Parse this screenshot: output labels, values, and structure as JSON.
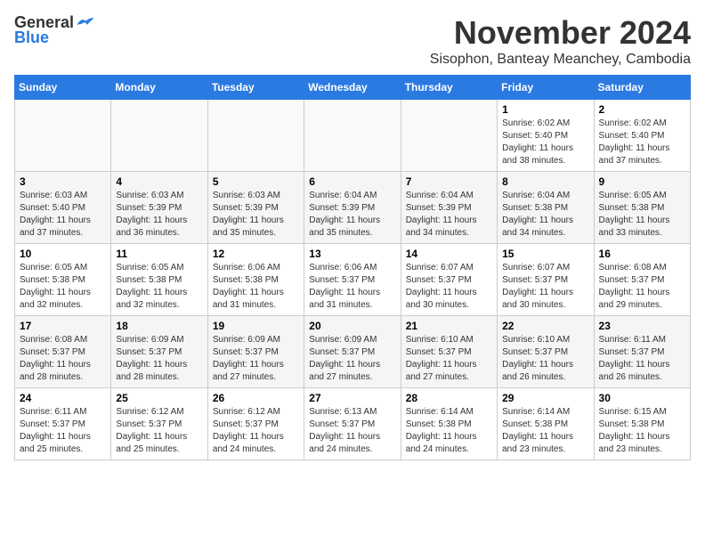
{
  "header": {
    "logo_general": "General",
    "logo_blue": "Blue",
    "month_title": "November 2024",
    "subtitle": "Sisophon, Banteay Meanchey, Cambodia"
  },
  "days_of_week": [
    "Sunday",
    "Monday",
    "Tuesday",
    "Wednesday",
    "Thursday",
    "Friday",
    "Saturday"
  ],
  "weeks": [
    [
      {
        "day": "",
        "info": ""
      },
      {
        "day": "",
        "info": ""
      },
      {
        "day": "",
        "info": ""
      },
      {
        "day": "",
        "info": ""
      },
      {
        "day": "",
        "info": ""
      },
      {
        "day": "1",
        "info": "Sunrise: 6:02 AM\nSunset: 5:40 PM\nDaylight: 11 hours\nand 38 minutes."
      },
      {
        "day": "2",
        "info": "Sunrise: 6:02 AM\nSunset: 5:40 PM\nDaylight: 11 hours\nand 37 minutes."
      }
    ],
    [
      {
        "day": "3",
        "info": "Sunrise: 6:03 AM\nSunset: 5:40 PM\nDaylight: 11 hours\nand 37 minutes."
      },
      {
        "day": "4",
        "info": "Sunrise: 6:03 AM\nSunset: 5:39 PM\nDaylight: 11 hours\nand 36 minutes."
      },
      {
        "day": "5",
        "info": "Sunrise: 6:03 AM\nSunset: 5:39 PM\nDaylight: 11 hours\nand 35 minutes."
      },
      {
        "day": "6",
        "info": "Sunrise: 6:04 AM\nSunset: 5:39 PM\nDaylight: 11 hours\nand 35 minutes."
      },
      {
        "day": "7",
        "info": "Sunrise: 6:04 AM\nSunset: 5:39 PM\nDaylight: 11 hours\nand 34 minutes."
      },
      {
        "day": "8",
        "info": "Sunrise: 6:04 AM\nSunset: 5:38 PM\nDaylight: 11 hours\nand 34 minutes."
      },
      {
        "day": "9",
        "info": "Sunrise: 6:05 AM\nSunset: 5:38 PM\nDaylight: 11 hours\nand 33 minutes."
      }
    ],
    [
      {
        "day": "10",
        "info": "Sunrise: 6:05 AM\nSunset: 5:38 PM\nDaylight: 11 hours\nand 32 minutes."
      },
      {
        "day": "11",
        "info": "Sunrise: 6:05 AM\nSunset: 5:38 PM\nDaylight: 11 hours\nand 32 minutes."
      },
      {
        "day": "12",
        "info": "Sunrise: 6:06 AM\nSunset: 5:38 PM\nDaylight: 11 hours\nand 31 minutes."
      },
      {
        "day": "13",
        "info": "Sunrise: 6:06 AM\nSunset: 5:37 PM\nDaylight: 11 hours\nand 31 minutes."
      },
      {
        "day": "14",
        "info": "Sunrise: 6:07 AM\nSunset: 5:37 PM\nDaylight: 11 hours\nand 30 minutes."
      },
      {
        "day": "15",
        "info": "Sunrise: 6:07 AM\nSunset: 5:37 PM\nDaylight: 11 hours\nand 30 minutes."
      },
      {
        "day": "16",
        "info": "Sunrise: 6:08 AM\nSunset: 5:37 PM\nDaylight: 11 hours\nand 29 minutes."
      }
    ],
    [
      {
        "day": "17",
        "info": "Sunrise: 6:08 AM\nSunset: 5:37 PM\nDaylight: 11 hours\nand 28 minutes."
      },
      {
        "day": "18",
        "info": "Sunrise: 6:09 AM\nSunset: 5:37 PM\nDaylight: 11 hours\nand 28 minutes."
      },
      {
        "day": "19",
        "info": "Sunrise: 6:09 AM\nSunset: 5:37 PM\nDaylight: 11 hours\nand 27 minutes."
      },
      {
        "day": "20",
        "info": "Sunrise: 6:09 AM\nSunset: 5:37 PM\nDaylight: 11 hours\nand 27 minutes."
      },
      {
        "day": "21",
        "info": "Sunrise: 6:10 AM\nSunset: 5:37 PM\nDaylight: 11 hours\nand 27 minutes."
      },
      {
        "day": "22",
        "info": "Sunrise: 6:10 AM\nSunset: 5:37 PM\nDaylight: 11 hours\nand 26 minutes."
      },
      {
        "day": "23",
        "info": "Sunrise: 6:11 AM\nSunset: 5:37 PM\nDaylight: 11 hours\nand 26 minutes."
      }
    ],
    [
      {
        "day": "24",
        "info": "Sunrise: 6:11 AM\nSunset: 5:37 PM\nDaylight: 11 hours\nand 25 minutes."
      },
      {
        "day": "25",
        "info": "Sunrise: 6:12 AM\nSunset: 5:37 PM\nDaylight: 11 hours\nand 25 minutes."
      },
      {
        "day": "26",
        "info": "Sunrise: 6:12 AM\nSunset: 5:37 PM\nDaylight: 11 hours\nand 24 minutes."
      },
      {
        "day": "27",
        "info": "Sunrise: 6:13 AM\nSunset: 5:37 PM\nDaylight: 11 hours\nand 24 minutes."
      },
      {
        "day": "28",
        "info": "Sunrise: 6:14 AM\nSunset: 5:38 PM\nDaylight: 11 hours\nand 24 minutes."
      },
      {
        "day": "29",
        "info": "Sunrise: 6:14 AM\nSunset: 5:38 PM\nDaylight: 11 hours\nand 23 minutes."
      },
      {
        "day": "30",
        "info": "Sunrise: 6:15 AM\nSunset: 5:38 PM\nDaylight: 11 hours\nand 23 minutes."
      }
    ]
  ]
}
